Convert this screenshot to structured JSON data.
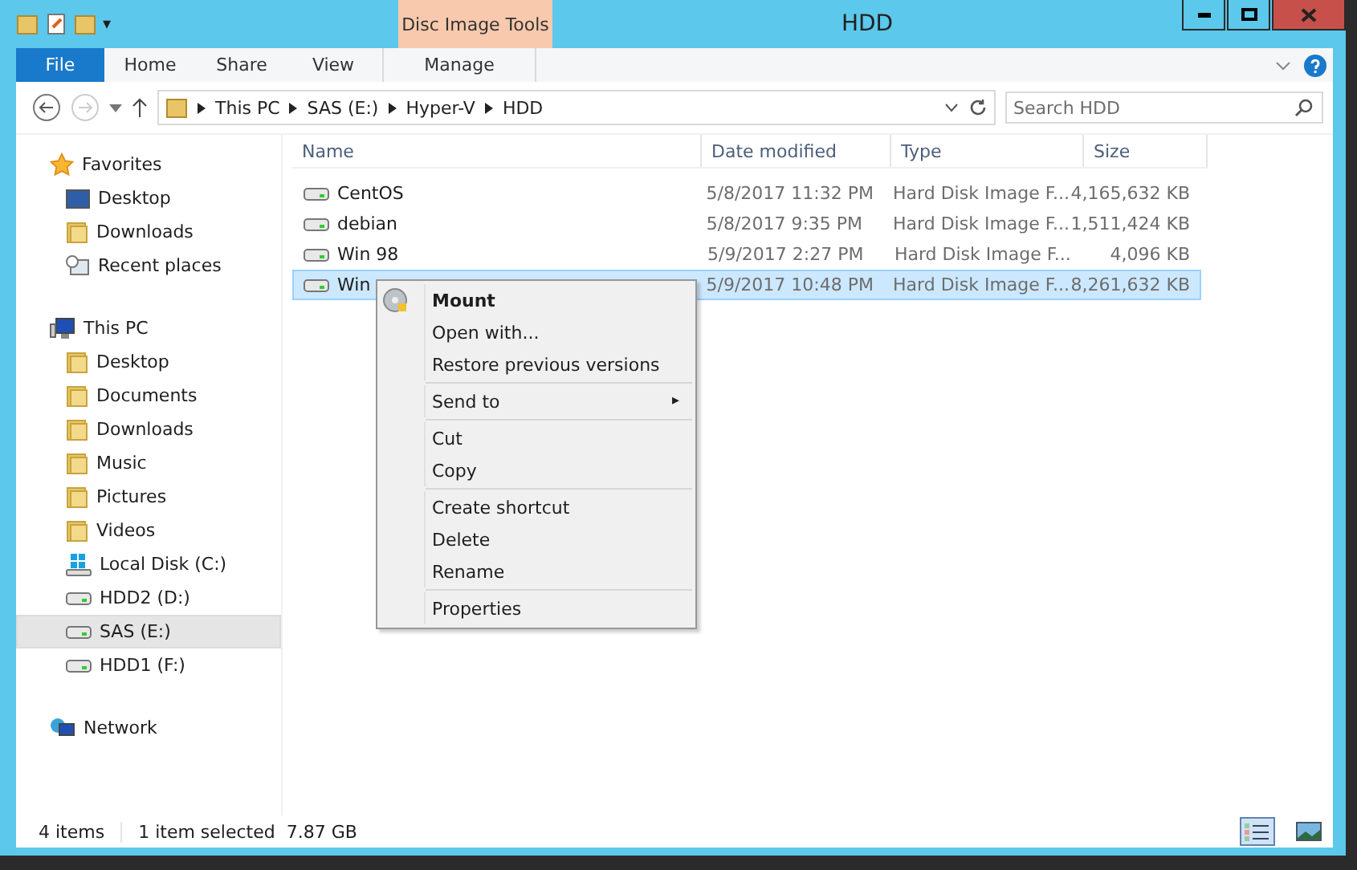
{
  "window": {
    "title": "HDD",
    "context_tab": "Disc Image Tools"
  },
  "quick_access": {
    "menu_glyph": "▾"
  },
  "ribbon_tabs": [
    {
      "label": "File",
      "kind": "file"
    },
    {
      "label": "Home",
      "kind": "tab"
    },
    {
      "label": "Share",
      "kind": "tab"
    },
    {
      "label": "View",
      "kind": "tab"
    },
    {
      "label": "Manage",
      "kind": "context"
    }
  ],
  "address_bar": {
    "segments": [
      "This PC",
      "SAS (E:)",
      "Hyper-V",
      "HDD"
    ]
  },
  "search": {
    "placeholder": "Search HDD"
  },
  "sidebar": [
    {
      "label": "Favorites",
      "kind": "star",
      "selected": false,
      "children": [
        {
          "label": "Desktop",
          "kind": "desktop",
          "selected": false
        },
        {
          "label": "Downloads",
          "kind": "folder",
          "selected": false
        },
        {
          "label": "Recent places",
          "kind": "recent",
          "selected": false
        }
      ]
    },
    {
      "label": "This PC",
      "kind": "pc",
      "selected": false,
      "children": [
        {
          "label": "Desktop",
          "kind": "folder",
          "selected": false
        },
        {
          "label": "Documents",
          "kind": "folder",
          "selected": false
        },
        {
          "label": "Downloads",
          "kind": "folder",
          "selected": false
        },
        {
          "label": "Music",
          "kind": "folder",
          "selected": false
        },
        {
          "label": "Pictures",
          "kind": "folder",
          "selected": false
        },
        {
          "label": "Videos",
          "kind": "folder",
          "selected": false
        },
        {
          "label": "Local Disk (C:)",
          "kind": "windisk",
          "selected": false
        },
        {
          "label": "HDD2 (D:)",
          "kind": "drive",
          "selected": false
        },
        {
          "label": "SAS (E:)",
          "kind": "drive",
          "selected": true
        },
        {
          "label": "HDD1 (F:)",
          "kind": "drive",
          "selected": false
        }
      ]
    },
    {
      "label": "Network",
      "kind": "network",
      "selected": false
    }
  ],
  "table": {
    "columns": [
      "Name",
      "Date modified",
      "Type",
      "Size"
    ],
    "rows": [
      {
        "name": "CentOS",
        "date": "5/8/2017 11:32 PM",
        "type": "Hard Disk Image F...",
        "size": "4,165,632 KB",
        "selected": false
      },
      {
        "name": "debian",
        "date": "5/8/2017 9:35 PM",
        "type": "Hard Disk Image F...",
        "size": "1,511,424 KB",
        "selected": false
      },
      {
        "name": "Win 98",
        "date": "5/9/2017 2:27 PM",
        "type": "Hard Disk Image F...",
        "size": "4,096 KB",
        "selected": false
      },
      {
        "name": "Win",
        "date": "5/9/2017 10:48 PM",
        "type": "Hard Disk Image F...",
        "size": "8,261,632 KB",
        "selected": true
      }
    ]
  },
  "context_menu": [
    [
      {
        "label": "Mount",
        "bold": true,
        "submenu": false
      },
      {
        "label": "Open with...",
        "bold": false,
        "submenu": false
      },
      {
        "label": "Restore previous versions",
        "bold": false,
        "submenu": false
      }
    ],
    [
      {
        "label": "Send to",
        "bold": false,
        "submenu": true
      }
    ],
    [
      {
        "label": "Cut",
        "bold": false,
        "submenu": false
      },
      {
        "label": "Copy",
        "bold": false,
        "submenu": false
      }
    ],
    [
      {
        "label": "Create shortcut",
        "bold": false,
        "submenu": false
      },
      {
        "label": "Delete",
        "bold": false,
        "submenu": false
      },
      {
        "label": "Rename",
        "bold": false,
        "submenu": false
      }
    ],
    [
      {
        "label": "Properties",
        "bold": false,
        "submenu": false
      }
    ]
  ],
  "submenu_glyph": "▸",
  "status_bar": {
    "count": "4 items",
    "selection": "1 item selected  7.87 GB"
  },
  "view_buttons": [
    {
      "kind": "details",
      "selected": true
    },
    {
      "kind": "tiles",
      "selected": false
    }
  ]
}
